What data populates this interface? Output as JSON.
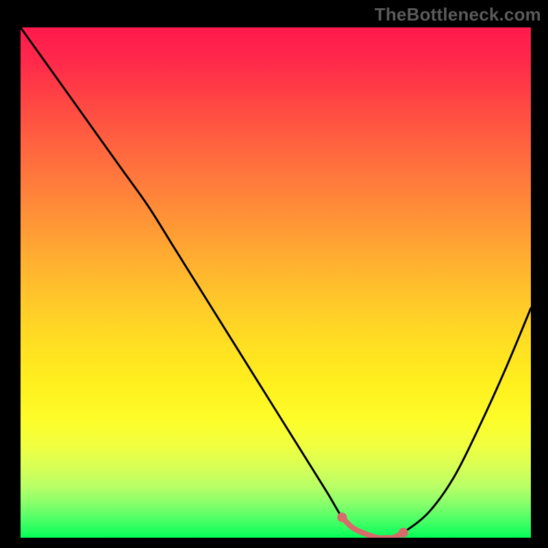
{
  "watermark": "TheBottleneck.com",
  "colors": {
    "highlight": "#d76a6a",
    "curve": "#000000"
  },
  "chart_data": {
    "type": "line",
    "title": "",
    "xlabel": "",
    "ylabel": "",
    "xlim": [
      0,
      100
    ],
    "ylim": [
      0,
      100
    ],
    "grid": false,
    "series": [
      {
        "name": "bottleneck-curve",
        "x": [
          0,
          5,
          10,
          15,
          20,
          25,
          30,
          35,
          40,
          45,
          50,
          55,
          60,
          63,
          65,
          67,
          70,
          72,
          73,
          75,
          80,
          85,
          90,
          95,
          100
        ],
        "values": [
          100,
          93,
          86,
          79,
          72,
          65,
          57,
          49,
          41,
          33,
          25,
          17,
          9,
          4,
          2,
          1,
          0,
          0,
          0,
          1,
          5,
          12,
          22,
          33,
          45
        ]
      }
    ],
    "highlight": {
      "range_x": [
        63,
        75
      ],
      "dots_x": [
        63,
        75
      ],
      "color_key": "highlight"
    },
    "gradient_stops": [
      {
        "pct": 0,
        "c": "#ff1a4d"
      },
      {
        "pct": 50,
        "c": "#ffc92a"
      },
      {
        "pct": 80,
        "c": "#fdfd2a"
      },
      {
        "pct": 100,
        "c": "#00ff55"
      }
    ]
  }
}
